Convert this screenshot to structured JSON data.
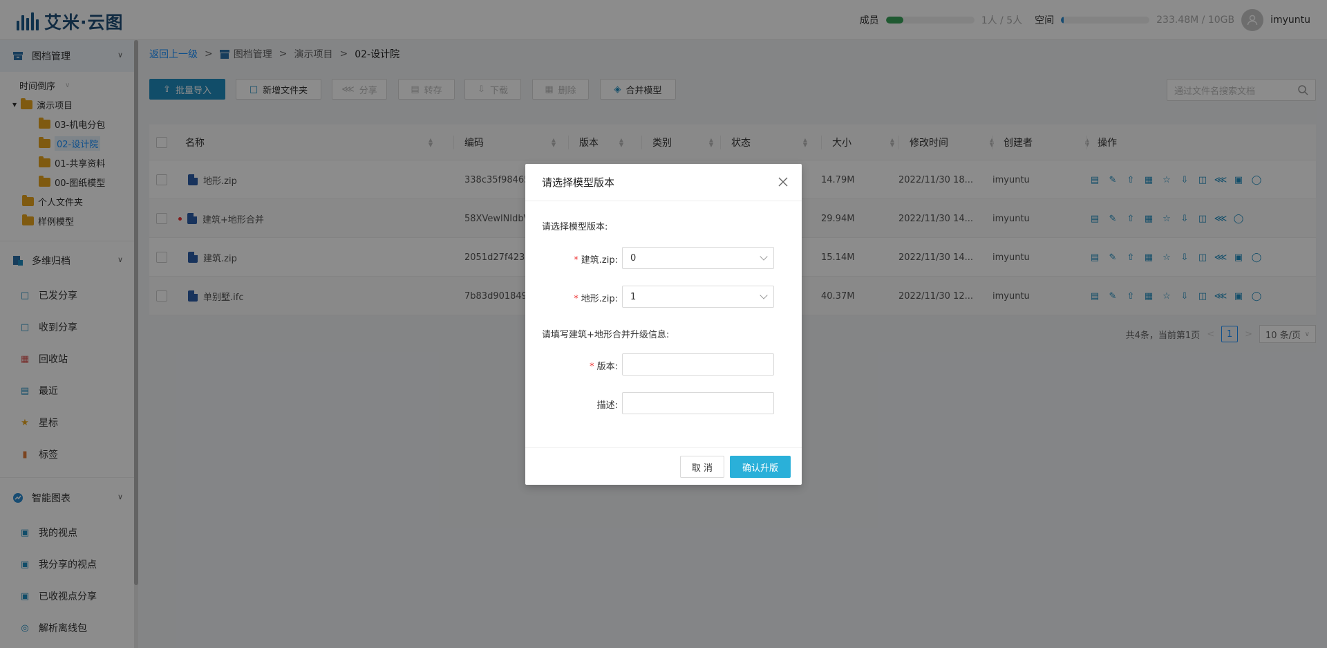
{
  "app": {
    "title": "艾米·云图"
  },
  "header": {
    "members_label": "成员",
    "members_value": "1人 / 5人",
    "members_progress": 0.2,
    "space_label": "空间",
    "space_value": "233.48M / 10GB",
    "space_progress": 0.02,
    "username": "imyuntu"
  },
  "sidebar": {
    "group1": "图档管理",
    "sort_label": "时间倒序",
    "tree": [
      "演示项目",
      "03-机电分包",
      "02-设计院",
      "01-共享资料",
      "00-图纸模型",
      "个人文件夹",
      "样例模型"
    ],
    "group2": "多维归档",
    "nav2": [
      "已发分享",
      "收到分享",
      "回收站",
      "最近",
      "星标",
      "标签"
    ],
    "group3": "智能图表",
    "nav3": [
      "我的视点",
      "我分享的视点",
      "已收视点分享",
      "解析离线包"
    ]
  },
  "breadcrumb": {
    "back": "返回上一级",
    "sep": ">",
    "root": "图档管理",
    "project": "演示项目",
    "current": "02-设计院"
  },
  "toolbar": {
    "import": "批量导入",
    "new_folder": "新增文件夹",
    "share": "分享",
    "transfer": "转存",
    "download": "下载",
    "delete": "删除",
    "merge": "合并模型",
    "search_placeholder": "通过文件名搜索文档"
  },
  "table": {
    "headers": [
      "名称",
      "编码",
      "版本",
      "类别",
      "状态",
      "大小",
      "修改时间",
      "创建者",
      "操作"
    ],
    "rows": [
      {
        "name": "地形.zip",
        "code": "338c35f98465",
        "size": "14.79M",
        "modified": "2022/11/30 18...",
        "creator": "imyuntu"
      },
      {
        "name": "建筑+地形合并",
        "code": "58XVewlNIdbV",
        "size": "29.94M",
        "modified": "2022/11/30 14...",
        "creator": "imyuntu"
      },
      {
        "name": "建筑.zip",
        "code": "2051d27f423b",
        "size": "15.14M",
        "modified": "2022/11/30 14...",
        "creator": "imyuntu"
      },
      {
        "name": "单别墅.ifc",
        "code": "7b83d9018495",
        "size": "40.37M",
        "modified": "2022/11/30 12...",
        "creator": "imyuntu"
      }
    ]
  },
  "pagination": {
    "summary": "共4条，当前第1页",
    "page": "1",
    "page_size": "10 条/页",
    "prev": "<",
    "next": ">"
  },
  "modal": {
    "title": "请选择模型版本",
    "section1": "请选择模型版本:",
    "field_building_label": "建筑.zip:",
    "field_building_value": "0",
    "field_terrain_label": "地形.zip:",
    "field_terrain_value": "1",
    "section2": "请填写建筑+地形合并升级信息:",
    "field_version_label": "版本:",
    "field_desc_label": "描述:",
    "required_mark": "*",
    "cancel": "取 消",
    "confirm": "确认升版"
  },
  "colors": {
    "primary": "#1f8dc0",
    "confirm": "#2ab0d9",
    "members_bar": "#3aa35a",
    "space_bar": "#2a8ad0",
    "folder": "#e7a51e"
  }
}
